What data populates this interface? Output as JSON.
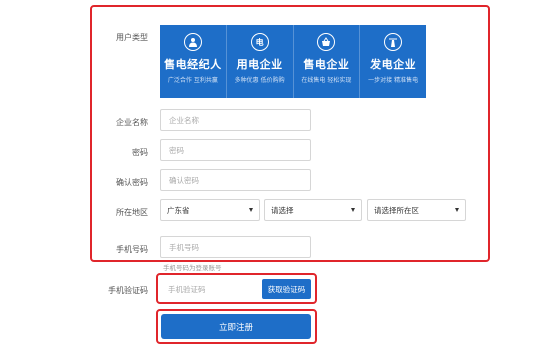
{
  "labels": {
    "user_type": "用户类型",
    "company": "企业名称",
    "password": "密码",
    "confirm": "确认密码",
    "region": "所在地区",
    "phone": "手机号码",
    "code": "手机验证码"
  },
  "user_types": [
    {
      "title": "售电经纪人",
      "sub": "广泛合作 互利共赢",
      "icon": "agent-icon"
    },
    {
      "title": "用电企业",
      "sub": "多种优惠 低价购购",
      "icon": "electricity-icon"
    },
    {
      "title": "售电企业",
      "sub": "在线售电 轻松实现",
      "icon": "basket-icon"
    },
    {
      "title": "发电企业",
      "sub": "一步对接 精准售电",
      "icon": "plant-icon"
    }
  ],
  "placeholders": {
    "company": "企业名称",
    "password": "密码",
    "confirm": "确认密码",
    "phone": "手机号码",
    "code": "手机验证码"
  },
  "region": {
    "province": "广东省",
    "city": "请选择",
    "district": "请选择所在区"
  },
  "phone_hint": "手机号码为登录账号",
  "buttons": {
    "get_code": "获取验证码",
    "submit": "立即注册"
  },
  "colors": {
    "accent": "#1e6ec8",
    "highlight": "#e0252b"
  }
}
